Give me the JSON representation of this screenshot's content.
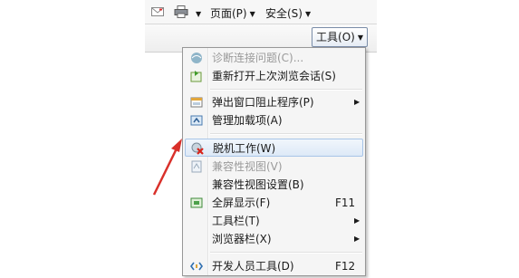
{
  "toolbar": {
    "page_label": "页面(P)",
    "security_label": "安全(S)",
    "tools_label": "工具(O)"
  },
  "menu": {
    "items": [
      {
        "label": "诊断连接问题(C)..."
      },
      {
        "label": "重新打开上次浏览会话(S)"
      },
      {
        "label": "弹出窗口阻止程序(P)"
      },
      {
        "label": "管理加载项(A)"
      },
      {
        "label": "脱机工作(W)"
      },
      {
        "label": "兼容性视图(V)"
      },
      {
        "label": "兼容性视图设置(B)"
      },
      {
        "label": "全屏显示(F)",
        "shortcut": "F11"
      },
      {
        "label": "工具栏(T)"
      },
      {
        "label": "浏览器栏(X)"
      },
      {
        "label": "开发人员工具(D)",
        "shortcut": "F12"
      }
    ]
  },
  "colors": {
    "arrow": "#d9302a",
    "highlight_border": "#a8c5e8",
    "menu_bg": "#f5f5f5"
  }
}
